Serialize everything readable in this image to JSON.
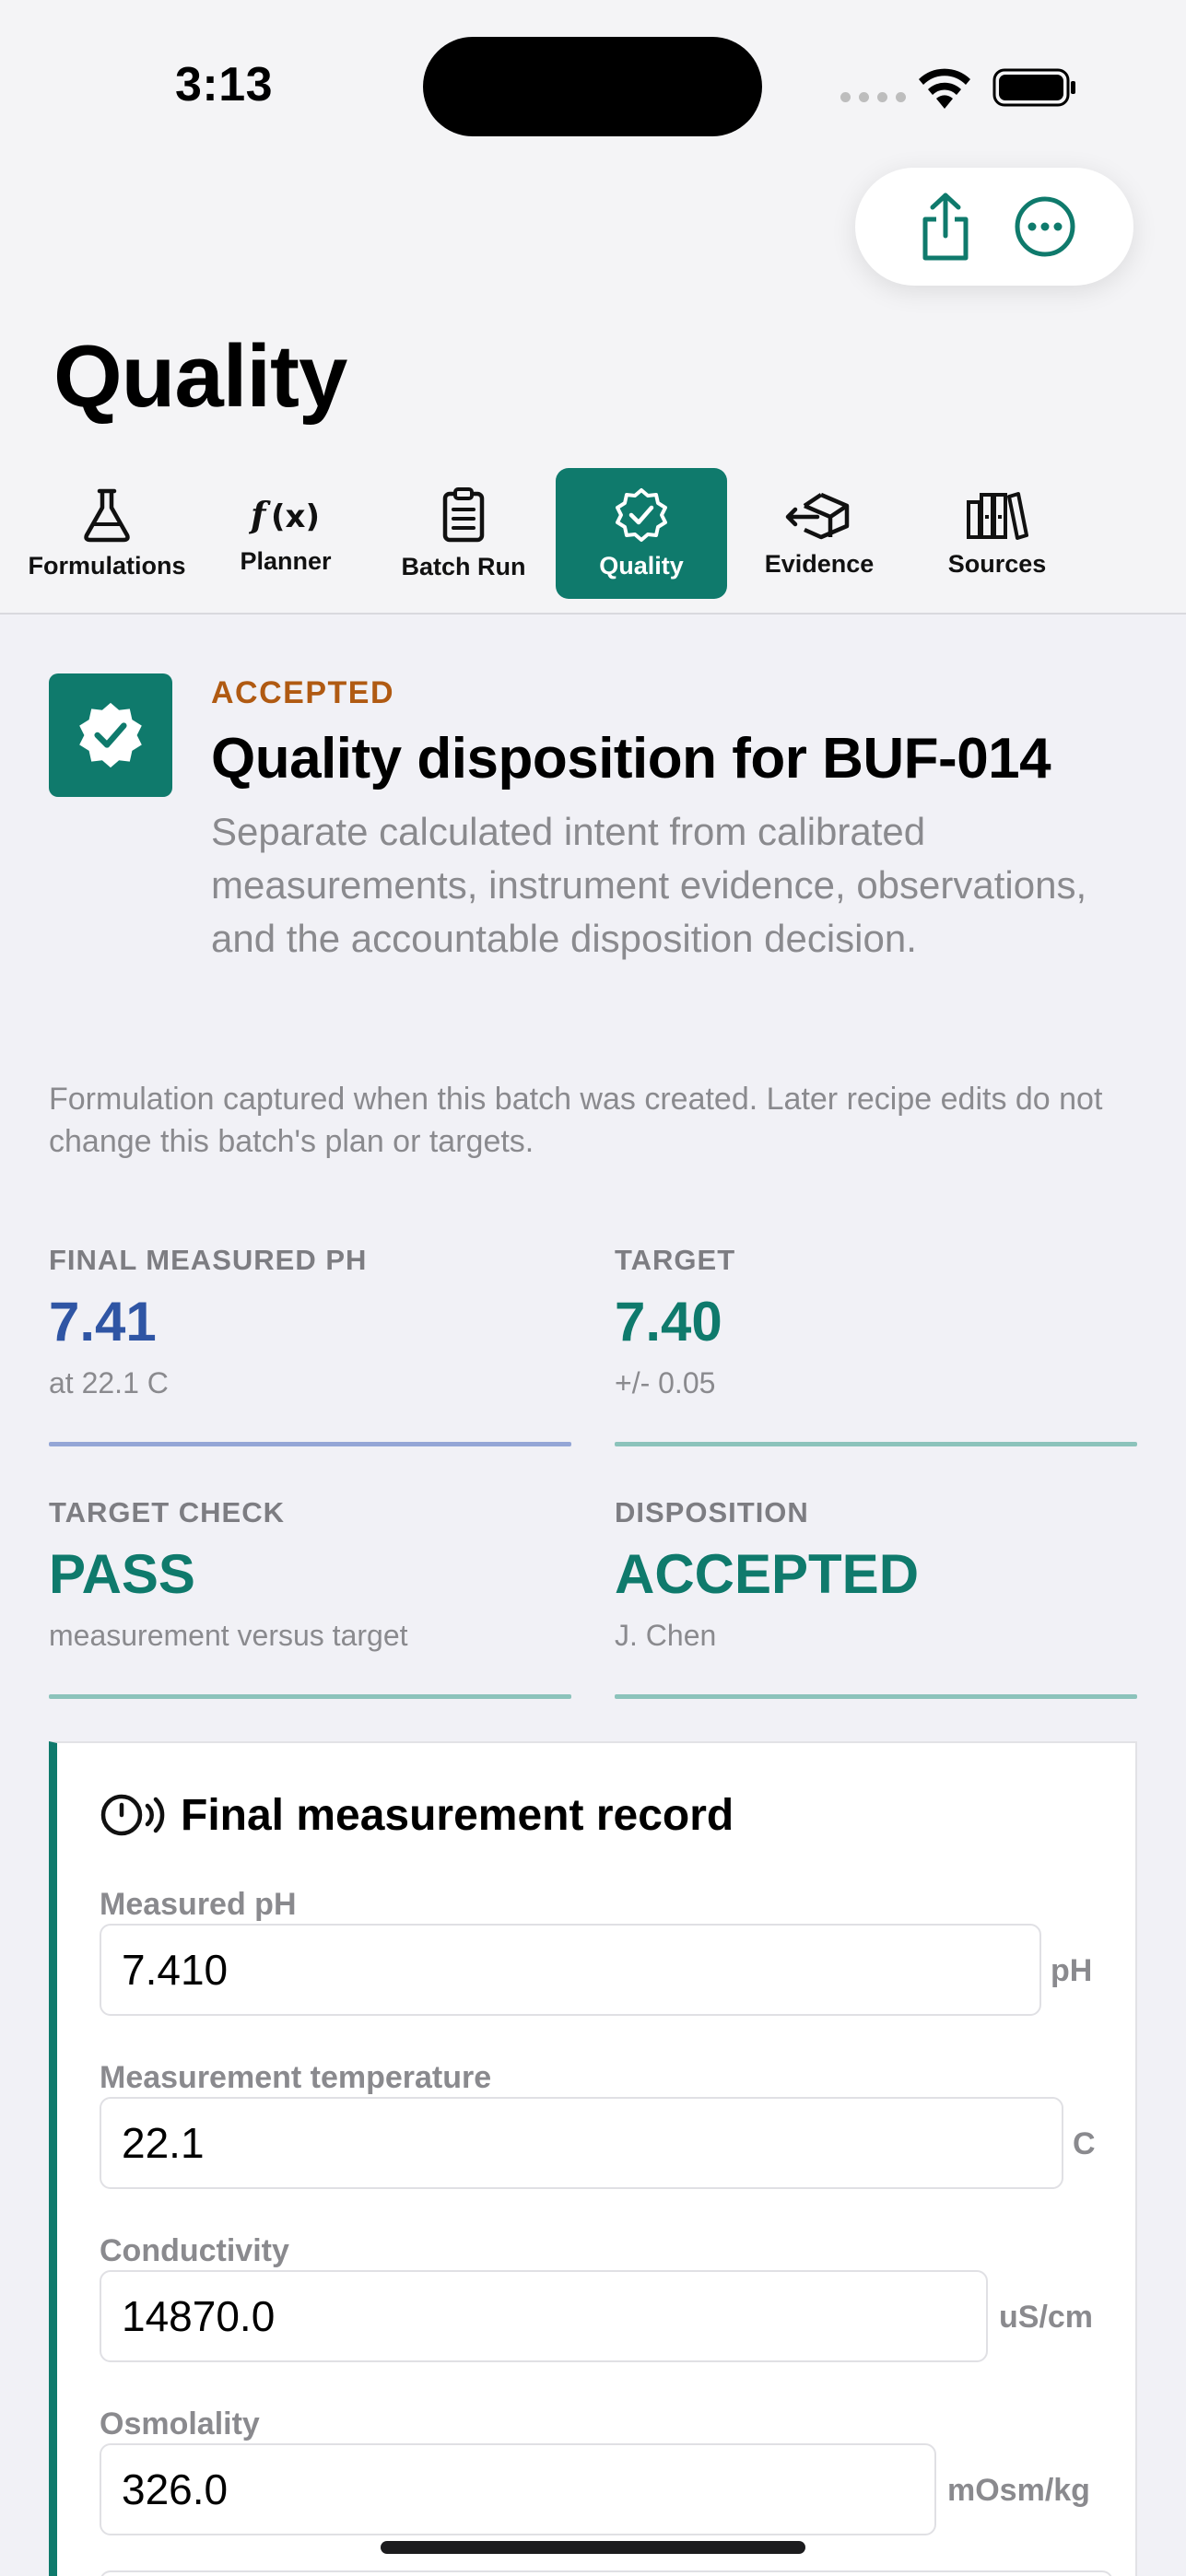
{
  "status_bar": {
    "time": "3:13"
  },
  "page": {
    "title": "Quality"
  },
  "tabs": [
    {
      "label": "Formulations",
      "icon": "flask-icon"
    },
    {
      "label": "Planner",
      "icon": "function-icon"
    },
    {
      "label": "Batch Run",
      "icon": "clipboard-icon"
    },
    {
      "label": "Quality",
      "icon": "seal-check-icon",
      "active": true
    },
    {
      "label": "Evidence",
      "icon": "box-arrow-icon"
    },
    {
      "label": "Sources",
      "icon": "books-icon"
    }
  ],
  "header": {
    "status": "ACCEPTED",
    "title": "Quality disposition for BUF-014",
    "description": "Separate calculated intent from calibrated measurements, instrument evidence, observations, and the accountable disposition decision.",
    "note": "Formulation captured when this batch was created. Later recipe edits do not change this batch's plan or targets."
  },
  "metrics": {
    "final_ph": {
      "label": "FINAL MEASURED PH",
      "value": "7.41",
      "sub": "at 22.1 C"
    },
    "target": {
      "label": "TARGET",
      "value": "7.40",
      "sub": "+/- 0.05"
    },
    "target_check": {
      "label": "TARGET CHECK",
      "value": "PASS",
      "sub": "measurement versus target"
    },
    "disposition": {
      "label": "DISPOSITION",
      "value": "ACCEPTED",
      "sub": "J. Chen"
    }
  },
  "measurement": {
    "title": "Final measurement record",
    "fields": [
      {
        "label": "Measured pH",
        "value": "7.410",
        "unit": "pH"
      },
      {
        "label": "Measurement temperature",
        "value": "22.1",
        "unit": "C"
      },
      {
        "label": "Conductivity",
        "value": "14870.0",
        "unit": "uS/cm"
      },
      {
        "label": "Osmolality",
        "value": "326.0",
        "unit": "mOsm/kg"
      }
    ]
  },
  "colors": {
    "accent": "#0f7a6c",
    "status_orange": "#b05a12",
    "ph_blue": "#2f55a4",
    "teal_value": "#0f7a6c"
  }
}
